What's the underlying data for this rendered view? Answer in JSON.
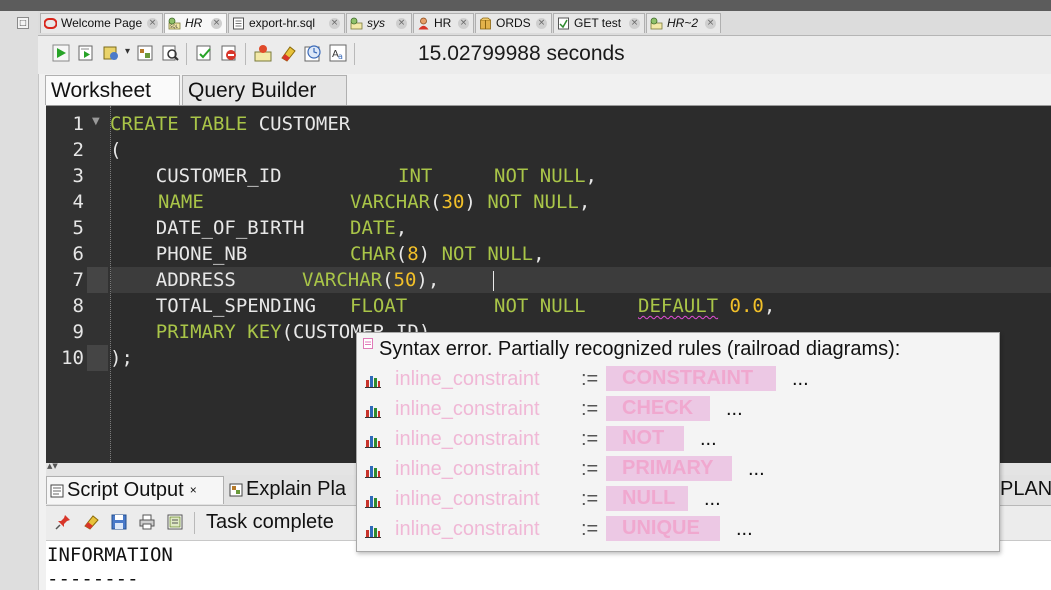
{
  "tabs": [
    {
      "label": "Welcome Page",
      "icon": "oracle-icon",
      "active": false,
      "italic": false
    },
    {
      "label": "HR",
      "icon": "sql-connection-icon",
      "active": true,
      "italic": true
    },
    {
      "label": "export-hr.sql",
      "icon": "sql-file-icon",
      "active": false,
      "italic": false
    },
    {
      "label": "sys",
      "icon": "sql-connection-icon",
      "active": false,
      "italic": true
    },
    {
      "label": "HR",
      "icon": "user-icon",
      "active": false,
      "italic": false
    },
    {
      "label": "ORDS",
      "icon": "package-icon",
      "active": false,
      "italic": false
    },
    {
      "label": "GET test",
      "icon": "rest-icon",
      "active": false,
      "italic": false
    },
    {
      "label": "HR~2",
      "icon": "sql-connection-icon",
      "active": false,
      "italic": true
    }
  ],
  "toolbar": {
    "elapsed": "15.02799988 seconds",
    "buttons": [
      "run-statement",
      "run-script",
      "autotrace",
      "commit",
      "rollback",
      "unshared-sql",
      "clear",
      "history",
      "sql-tuning",
      "explain",
      "format"
    ]
  },
  "worksheet_tabs": [
    "Worksheet",
    "Query Builder"
  ],
  "editor": {
    "line_numbers": [
      "1",
      "2",
      "3",
      "4",
      "5",
      "6",
      "7",
      "8",
      "9",
      "10"
    ],
    "current_line": 7,
    "colors": {
      "background": "#2c2c2c",
      "keyword": "#a9c548",
      "number": "#f2c029",
      "text": "#e8e8e8"
    }
  },
  "code": {
    "l1_kw": "CREATE TABLE",
    "l1_name": " CUSTOMER",
    "l2": "(",
    "l3_col": "    CUSTOMER_ID",
    "l3_type": "INT",
    "l3_nn": "NOT NULL",
    "l3_tail": ",",
    "l4_col": "NAME",
    "l4_type": "VARCHAR",
    "l4_open": "(",
    "l4_num": "30",
    "l4_close": ")",
    "l4_nn": "NOT NULL",
    "l4_tail": ",",
    "l5_col": "    DATE_OF_BIRTH",
    "l5_type": "DATE",
    "l5_tail": ",",
    "l6_col": "    PHONE_NB",
    "l6_type": "CHAR",
    "l6_open": "(",
    "l6_num": "8",
    "l6_close": ")",
    "l6_nn": "NOT NULL",
    "l6_tail": ",",
    "l7_col": "    ADDRESS",
    "l7_type": "VARCHAR",
    "l7_open": "(",
    "l7_num": "50",
    "l7_close": ")",
    "l7_tail": ",",
    "l8_col": "    TOTAL_SPENDING",
    "l8_type": "FLOAT",
    "l8_nn": "NOT NULL",
    "l8_default": "DEFAULT",
    "l8_num": "0.0",
    "l8_tail": ",",
    "l9_kw": "    PRIMARY KEY",
    "l9_rest": "(CUSTOMER_ID)",
    "l10": ");"
  },
  "popup": {
    "title": "Syntax error. Partially recognized rules (railroad diagrams):",
    "rules": [
      {
        "name": "inline_constraint",
        "assign": ":=",
        "token": "CONSTRAINT",
        "more": "..."
      },
      {
        "name": "inline_constraint",
        "assign": ":=",
        "token": "CHECK",
        "more": "..."
      },
      {
        "name": "inline_constraint",
        "assign": ":=",
        "token": "NOT",
        "more": "..."
      },
      {
        "name": "inline_constraint",
        "assign": ":=",
        "token": "PRIMARY",
        "more": "..."
      },
      {
        "name": "inline_constraint",
        "assign": ":=",
        "token": "NULL",
        "more": "..."
      },
      {
        "name": "inline_constraint",
        "assign": ":=",
        "token": "UNIQUE",
        "more": "..."
      }
    ]
  },
  "bottom_tabs": {
    "script_output": "Script Output",
    "close": "×",
    "explain": "Explain Pla",
    "plan": "PLAN"
  },
  "bottom_toolbar": {
    "status": "Task complete"
  },
  "output": {
    "line1": "INFORMATION",
    "line2": "--------"
  }
}
